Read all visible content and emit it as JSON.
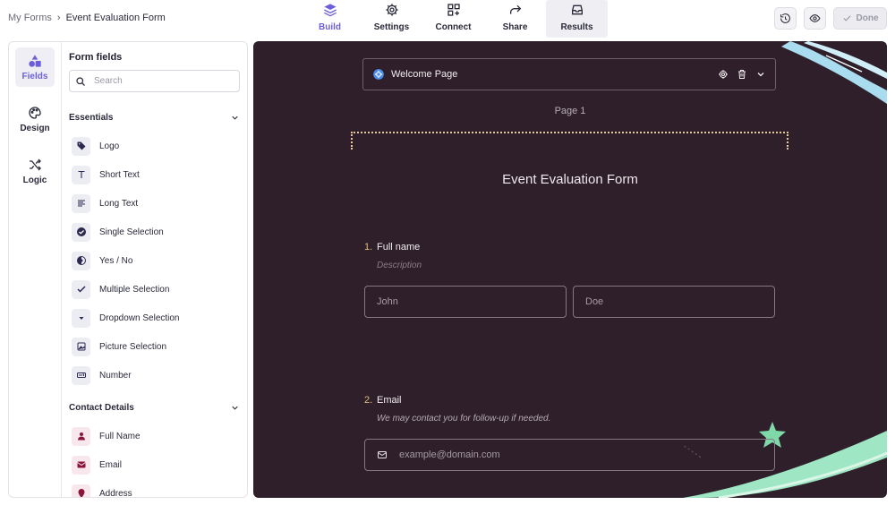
{
  "breadcrumb": {
    "root": "My Forms",
    "separator": "›",
    "current": "Event Evaluation Form"
  },
  "nav": {
    "tabs": [
      {
        "label": "Build",
        "icon": "layers-icon"
      },
      {
        "label": "Settings",
        "icon": "gear-icon"
      },
      {
        "label": "Connect",
        "icon": "apps-add-icon"
      },
      {
        "label": "Share",
        "icon": "share-arrow-icon"
      },
      {
        "label": "Results",
        "icon": "inbox-icon"
      }
    ],
    "active": "Build"
  },
  "actions": {
    "history_icon": "history-icon",
    "preview_icon": "eye-icon",
    "done_label": "Done"
  },
  "rail": [
    {
      "label": "Fields",
      "icon": "shapes-icon"
    },
    {
      "label": "Design",
      "icon": "palette-icon"
    },
    {
      "label": "Logic",
      "icon": "shuffle-icon"
    }
  ],
  "fields_panel": {
    "title": "Form fields",
    "search_placeholder": "Search",
    "sections": [
      {
        "title": "Essentials",
        "items": [
          {
            "label": "Logo",
            "icon": "tag-icon"
          },
          {
            "label": "Short Text",
            "icon": "text-t-icon"
          },
          {
            "label": "Long Text",
            "icon": "paragraph-icon"
          },
          {
            "label": "Single Selection",
            "icon": "check-circle-icon"
          },
          {
            "label": "Yes / No",
            "icon": "half-circle-icon"
          },
          {
            "label": "Multiple Selection",
            "icon": "checkmark-icon"
          },
          {
            "label": "Dropdown Selection",
            "icon": "caret-down-icon"
          },
          {
            "label": "Picture Selection",
            "icon": "image-icon"
          },
          {
            "label": "Number",
            "icon": "number-icon"
          }
        ]
      },
      {
        "title": "Contact Details",
        "items": [
          {
            "label": "Full Name",
            "icon": "person-icon"
          },
          {
            "label": "Email",
            "icon": "envelope-icon"
          },
          {
            "label": "Address",
            "icon": "pin-icon"
          }
        ]
      }
    ]
  },
  "canvas": {
    "welcome_label": "Welcome Page",
    "page_label": "Page 1",
    "form_title": "Event Evaluation Form",
    "questions": [
      {
        "number": "1.",
        "title": "Full name",
        "description": "Description",
        "first_placeholder": "John",
        "last_placeholder": "Doe"
      },
      {
        "number": "2.",
        "title": "Email",
        "description": "We may contact you for follow-up if needed.",
        "placeholder": "example@domain.com"
      }
    ]
  },
  "colors": {
    "accent": "#6d5fd8",
    "canvas_bg": "#2e1f2a",
    "number_gold": "#e0c07a",
    "deco_blue": "#a9dcef",
    "deco_mint": "#9fe6c4",
    "pink_icon": "#8a1538"
  }
}
